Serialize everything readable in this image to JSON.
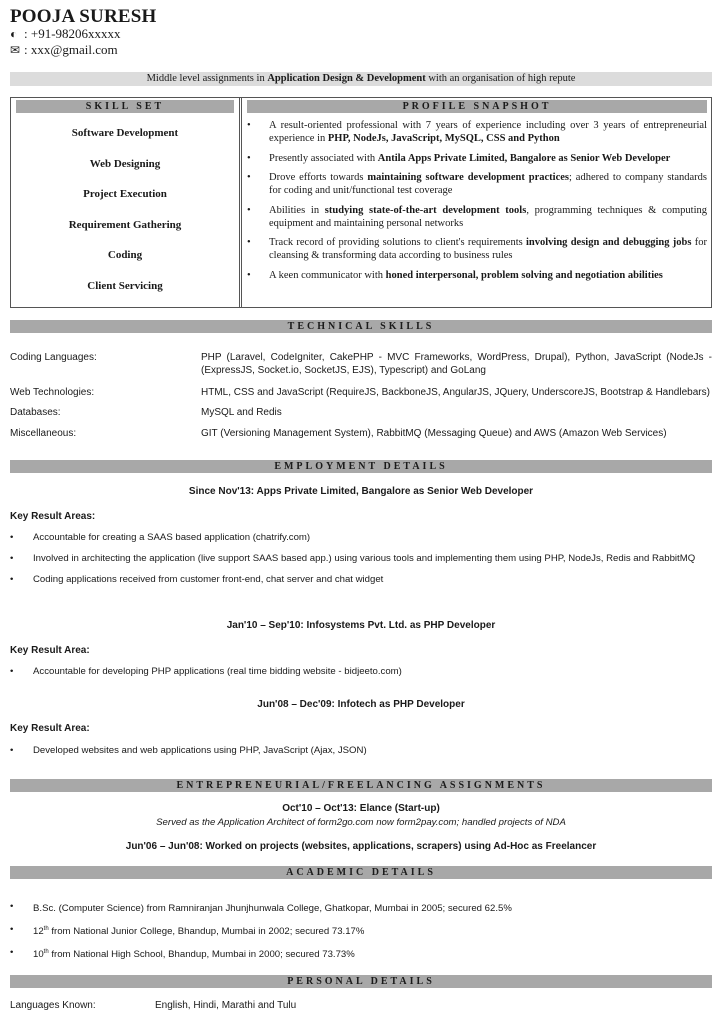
{
  "header": {
    "name": "POOJA SURESH",
    "phone_icon": "phone-icon",
    "phone": ": +91-98206xxxxx",
    "email_icon": "envelope-icon",
    "email": ": xxx@gmail.com"
  },
  "tagline": {
    "prefix": "Middle level assignments in ",
    "bold": "Application Design & Development",
    "suffix": " with an organisation of high repute"
  },
  "skill_set": {
    "title": "SKILL SET",
    "items": [
      "Software Development",
      "Web Designing",
      "Project Execution",
      "Requirement Gathering",
      "Coding",
      "Client Servicing"
    ]
  },
  "profile_snapshot": {
    "title": "PROFILE SNAPSHOT",
    "items": [
      {
        "pre": "A result-oriented professional with 7 years of experience including over 3 years of entrepreneurial experience in ",
        "bold": "PHP, NodeJs, JavaScript, MySQL, CSS and Python",
        "post": ""
      },
      {
        "pre": "Presently associated with ",
        "bold": "Antila Apps Private Limited, Bangalore as Senior Web Developer",
        "post": ""
      },
      {
        "pre": "Drove efforts towards ",
        "bold": "maintaining software development practices",
        "post": "; adhered to company standards for coding and unit/functional test coverage"
      },
      {
        "pre": "Abilities in ",
        "bold": "studying state-of-the-art development tools",
        "post": ", programming techniques & computing equipment and maintaining personal networks"
      },
      {
        "pre": "Track record of providing solutions to client's requirements ",
        "bold": "involving design and debugging jobs",
        "post": " for cleansing & transforming data according to business rules"
      },
      {
        "pre": "A keen communicator with ",
        "bold": "honed interpersonal, problem solving and negotiation abilities",
        "post": ""
      }
    ]
  },
  "technical_skills": {
    "title": "TECHNICAL SKILLS",
    "rows": [
      {
        "label": "Coding Languages:",
        "value": "PHP (Laravel, CodeIgniter, CakePHP - MVC Frameworks, WordPress, Drupal), Python, JavaScript (NodeJs - (ExpressJS, Socket.io, SocketJS, EJS), Typescript) and GoLang"
      },
      {
        "label": "Web Technologies:",
        "value": "HTML, CSS and JavaScript (RequireJS, BackboneJS, AngularJS, JQuery, UnderscoreJS, Bootstrap & Handlebars)"
      },
      {
        "label": "Databases:",
        "value": "MySQL and Redis"
      },
      {
        "label": "Miscellaneous:",
        "value": "GIT (Versioning Management System), RabbitMQ (Messaging Queue) and AWS (Amazon Web Services)"
      }
    ]
  },
  "employment": {
    "title": "EMPLOYMENT DETAILS",
    "jobs": [
      {
        "title": "Since Nov'13: Apps Private Limited, Bangalore as Senior Web Developer",
        "kra_label": "Key Result Areas:",
        "items": [
          "Accountable for creating a SAAS based application (chatrify.com)",
          "Involved in architecting the application (live support SAAS based app.) using various tools and implementing them using PHP, NodeJs, Redis and RabbitMQ",
          "Coding applications received from customer front-end, chat server and chat widget"
        ]
      },
      {
        "title": "Jan'10 – Sep'10: Infosystems Pvt. Ltd. as PHP Developer",
        "kra_label": "Key Result Area:",
        "items": [
          "Accountable for developing PHP applications (real time bidding website - bidjeeto.com)"
        ]
      },
      {
        "title": "Jun'08 – Dec'09: Infotech as PHP Developer",
        "kra_label": "Key Result Area:",
        "items": [
          "Developed websites and web applications using PHP, JavaScript (Ajax, JSON)"
        ]
      }
    ]
  },
  "freelancing": {
    "title": "ENTREPRENEURIAL/FREELANCING ASSIGNMENTS",
    "entries": [
      {
        "title": "Oct'10 – Oct'13: Elance (Start-up)",
        "desc": "Served as the Application Architect of form2go.com now form2pay.com; handled projects of NDA"
      },
      {
        "title": "Jun'06 – Jun'08: Worked on projects (websites, applications, scrapers) using Ad-Hoc as Freelancer",
        "desc": ""
      }
    ]
  },
  "academic": {
    "title": "ACADEMIC DETAILS",
    "items": [
      {
        "pre": "B.Sc. (Computer Science) from Ramniranjan Jhunjhunwala College, Ghatkopar, Mumbai in 2005; secured 62.5%",
        "sup": "",
        "post": ""
      },
      {
        "pre": "12",
        "sup": "th",
        "post": " from National Junior College, Bhandup, Mumbai in 2002; secured 73.17%"
      },
      {
        "pre": "10",
        "sup": "th",
        "post": " from National High School, Bhandup, Mumbai in 2000; secured 73.73%"
      }
    ]
  },
  "personal": {
    "title": "PERSONAL DETAILS",
    "languages_label": "Languages Known:",
    "languages_value": "English, Hindi, Marathi and Tulu"
  }
}
